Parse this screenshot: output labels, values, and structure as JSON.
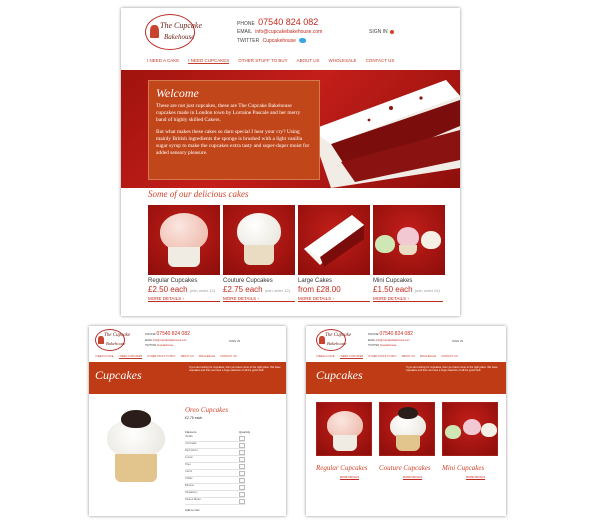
{
  "site": {
    "logo_line1": "The Cupcake",
    "logo_line2": "Bakehouse",
    "phone_label": "PHONE",
    "phone": "07540 824 082",
    "email_label": "EMAIL",
    "email": "info@cupcakebakehouse.com",
    "twitter_label": "TWITTER",
    "twitter": "Cupcakehouse",
    "signin": "SIGN IN",
    "nav": [
      "I NEED A CAKE",
      "I NEED CUPCAKES",
      "OTHER STUFF TO BUY",
      "ABOUT US",
      "WHOLESALE",
      "CONTACT US"
    ]
  },
  "home": {
    "welcome_title": "Welcome",
    "welcome_p1": "These are not just cupcakes, these are The Cupcake Bakehouse cupcakes made in London town by Lorraine Pascale and her merry band of highly skilled Cakers.",
    "welcome_p2": "But what makes these cakes so darn special I hear your cry? Using mainly British ingredients the sponge is brushed with a light vanilla sugar syrup to make the cupcakes extra tasty and super-duper moist for added sensory pleasure.",
    "section_title": "Some of our delicious cakes",
    "products": [
      {
        "name": "Regular Cupcakes",
        "price": "£2.50 each",
        "min": "(min order 12)",
        "more": "MORE DETAILS"
      },
      {
        "name": "Couture Cupcakes",
        "price": "£2.75 each",
        "min": "(min order 12)",
        "more": "MORE DETAILS"
      },
      {
        "name": "Large Cakes",
        "price": "from £28.00",
        "min": "",
        "more": "MORE DETAILS"
      },
      {
        "name": "Mini Cupcakes",
        "price": "£1.50 each",
        "min": "(min order 24)",
        "more": "MORE DETAILS"
      }
    ]
  },
  "product_page": {
    "band_title": "Cupcakes",
    "band_text": "If you are looking for cupcakes, then you have come to the right place. We have cupcakes and then we have a huge selection of all the good stuff.",
    "product_title": "Oreo Cupcakes",
    "price": "£2.75 each",
    "flavours_label": "Flavours",
    "quantity_label": "Quantity",
    "flavours": [
      "Vanilla",
      "Chocolate",
      "Red Velvet",
      "Lemon",
      "Oreo",
      "Carrot",
      "Coffee",
      "Banana",
      "Strawberry",
      "Peanut Butter"
    ],
    "add_to_cart": "Add to cart"
  },
  "list_page": {
    "band_title": "Cupcakes",
    "band_text": "If you are looking for cupcakes, then you have come to the right place. We have cupcakes and then we have a huge selection of all the good stuff.",
    "items": [
      {
        "name": "Regular Cupcakes",
        "more": "MORE DETAILS"
      },
      {
        "name": "Couture Cupcakes",
        "more": "MORE DETAILS"
      },
      {
        "name": "Mini Cupcakes",
        "more": "MORE DETAILS"
      }
    ]
  },
  "colors": {
    "brand_red": "#c22b1f",
    "hero_red": "#b51a16",
    "welcome_orange": "#c1461a",
    "title_orange": "#d2442a"
  }
}
